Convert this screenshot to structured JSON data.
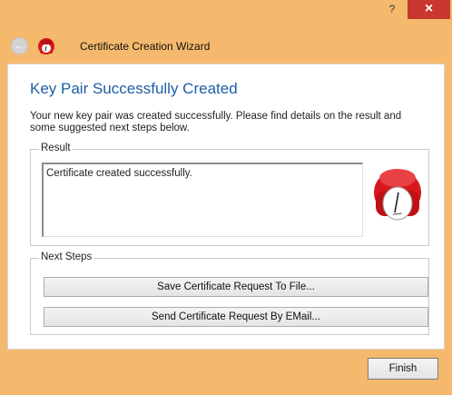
{
  "window": {
    "help_label": "?",
    "close_label": "×"
  },
  "navbar": {
    "back_glyph": "←",
    "wizard_title": "Certificate Creation Wizard",
    "app_icon": "app-logo-icon"
  },
  "page": {
    "heading": "Key Pair Successfully Created",
    "intro": "Your new key pair was created successfully. Please find details on the result and some suggested next steps below."
  },
  "result": {
    "legend": "Result",
    "text": "Certificate created successfully."
  },
  "next_steps": {
    "legend": "Next Steps",
    "save_label": "Save Certificate Request To File...",
    "send_label": "Send Certificate Request By EMail..."
  },
  "footer": {
    "finish_label": "Finish"
  },
  "colors": {
    "title_bar": "#f5b96d",
    "heading": "#1d5fa7",
    "close_button": "#c7372f",
    "mascot_red": "#d8181d"
  }
}
